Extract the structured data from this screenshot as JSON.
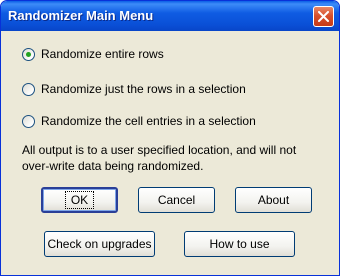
{
  "window": {
    "title": "Randomizer Main Menu"
  },
  "options": [
    {
      "label": "Randomize entire rows",
      "selected": true
    },
    {
      "label": "Randomize just the rows in a selection",
      "selected": false
    },
    {
      "label": "Randomize the cell entries in a selection",
      "selected": false
    }
  ],
  "note": "All output is to a user specified location, and will not over-write data being randomized.",
  "buttons": {
    "ok": "OK",
    "cancel": "Cancel",
    "about": "About",
    "check_upgrades": "Check on upgrades",
    "how_to_use": "How to use"
  },
  "colors": {
    "titlebar": "#0a4fd6",
    "close": "#d8502d",
    "face": "#ece9d8",
    "radio_dot": "#21a121"
  }
}
